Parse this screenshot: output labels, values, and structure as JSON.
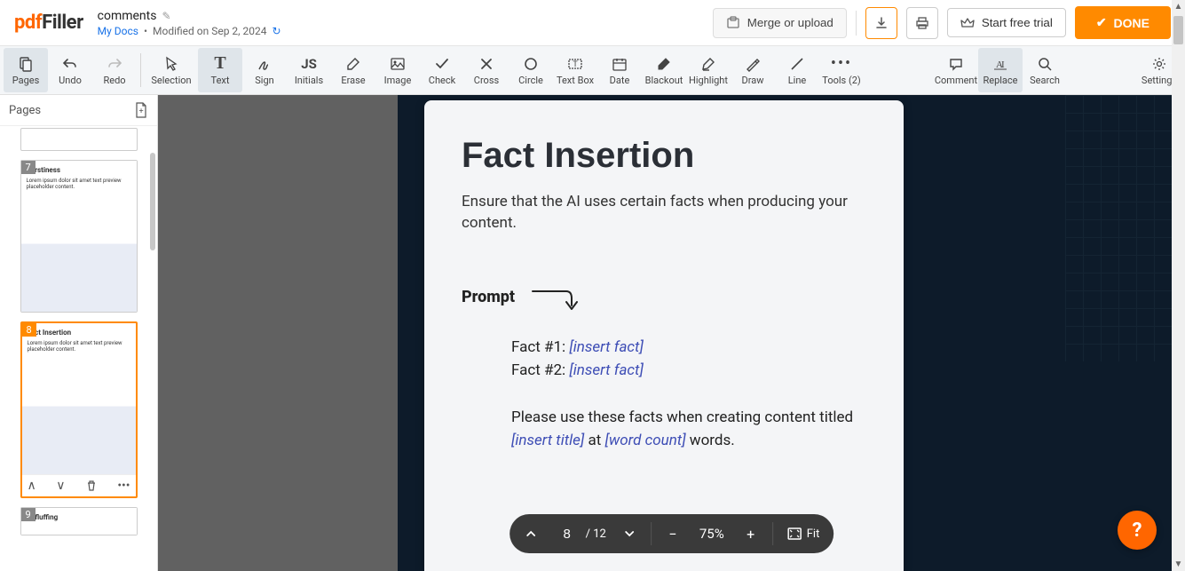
{
  "header": {
    "logo_pdf": "pdf",
    "logo_filler": "Filler",
    "doc_title": "comments",
    "my_docs": "My Docs",
    "modified": "Modified on Sep 2, 2024",
    "merge": "Merge or upload",
    "trial": "Start free trial",
    "done": "DONE"
  },
  "toolbar": [
    {
      "id": "pages",
      "label": "Pages",
      "active": true
    },
    {
      "id": "undo",
      "label": "Undo"
    },
    {
      "id": "redo",
      "label": "Redo"
    },
    {
      "id": "sep"
    },
    {
      "id": "selection",
      "label": "Selection"
    },
    {
      "id": "text",
      "label": "Text",
      "active": true
    },
    {
      "id": "sign",
      "label": "Sign"
    },
    {
      "id": "initials",
      "label": "Initials"
    },
    {
      "id": "erase",
      "label": "Erase"
    },
    {
      "id": "image",
      "label": "Image"
    },
    {
      "id": "check",
      "label": "Check"
    },
    {
      "id": "cross",
      "label": "Cross"
    },
    {
      "id": "circle",
      "label": "Circle"
    },
    {
      "id": "textbox",
      "label": "Text Box"
    },
    {
      "id": "date",
      "label": "Date"
    },
    {
      "id": "blackout",
      "label": "Blackout"
    },
    {
      "id": "highlight",
      "label": "Highlight"
    },
    {
      "id": "draw",
      "label": "Draw"
    },
    {
      "id": "line",
      "label": "Line"
    },
    {
      "id": "tools",
      "label": "Tools (2)"
    },
    {
      "id": "spacer"
    },
    {
      "id": "comment",
      "label": "Comment"
    },
    {
      "id": "replace",
      "label": "Replace",
      "active": true
    },
    {
      "id": "search",
      "label": "Search"
    },
    {
      "id": "spacer2"
    },
    {
      "id": "settings",
      "label": "Settings"
    }
  ],
  "sidebar": {
    "title": "Pages",
    "thumbs": [
      {
        "num": "7",
        "title": "Burstiness"
      },
      {
        "num": "8",
        "title": "Fact Insertion",
        "selected": true
      },
      {
        "num": "9",
        "title": "Unfluffing"
      }
    ]
  },
  "page": {
    "title": "Fact Insertion",
    "subtitle": "Ensure that the AI uses certain facts when producing your content.",
    "prompt_label": "Prompt",
    "fact1_label": "Fact #1: ",
    "fact2_label": "Fact #2:  ",
    "insert_fact": "[insert fact]",
    "line2a": "Please use these facts when creating content titled ",
    "insert_title": "[insert title]",
    "line2b": " at ",
    "word_count": "[word count]",
    "line2c": " words."
  },
  "zoom": {
    "current_page": "8",
    "total": "/ 12",
    "zoom_level": "75%",
    "fit": "Fit"
  }
}
